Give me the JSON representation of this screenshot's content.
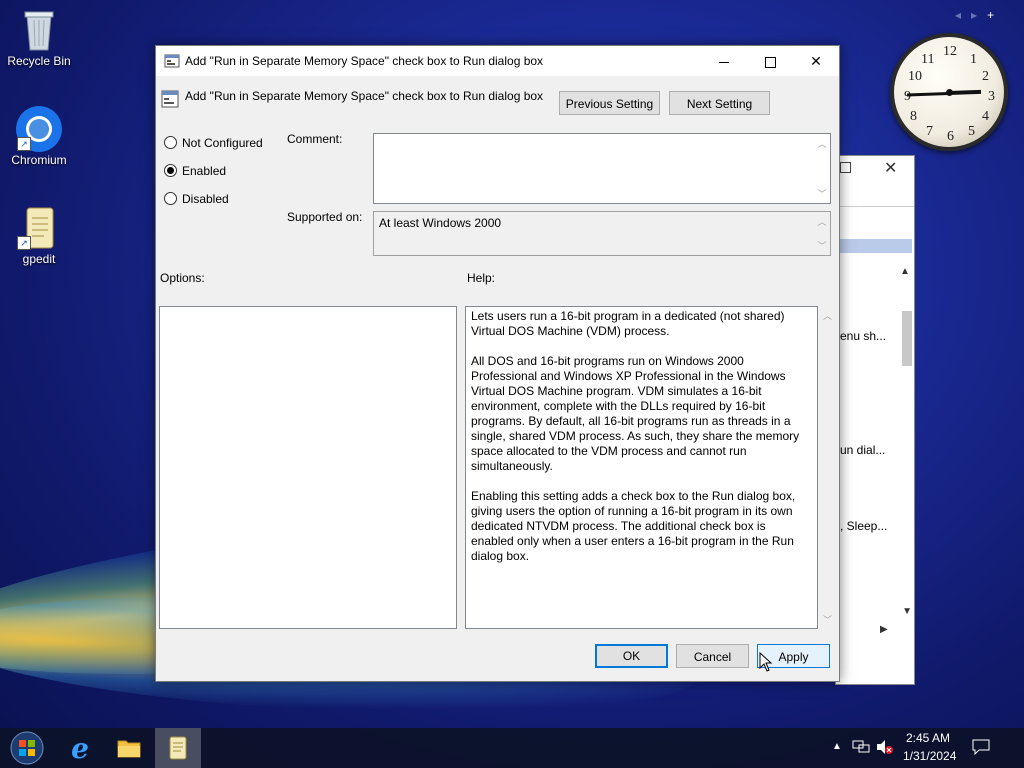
{
  "desktop": {
    "icons": [
      {
        "label": "Recycle Bin",
        "icon": "recycle-bin-icon"
      },
      {
        "label": "Chromium",
        "icon": "chromium-icon"
      },
      {
        "label": "gpedit",
        "icon": "gpedit-icon"
      }
    ],
    "top_right_glyphs": [
      "◂",
      "▸",
      "+"
    ]
  },
  "background_window": {
    "row1": "enu sh...",
    "row2": "un dial...",
    "row3": ", Sleep..."
  },
  "dialog": {
    "window_title": "Add \"Run in Separate Memory Space\" check box to Run dialog box",
    "setting_title": "Add \"Run in Separate Memory Space\" check box to Run dialog box",
    "prev_button": "Previous Setting",
    "next_button": "Next Setting",
    "radios": [
      {
        "label": "Not Configured",
        "selected": false
      },
      {
        "label": "Enabled",
        "selected": true
      },
      {
        "label": "Disabled",
        "selected": false
      }
    ],
    "comment_label": "Comment:",
    "comment_value": "",
    "supported_label": "Supported on:",
    "supported_value": "At least Windows 2000",
    "options_label": "Options:",
    "help_label": "Help:",
    "help_paragraphs": [
      "Lets users run a 16-bit program in a dedicated (not shared) Virtual DOS Machine (VDM) process.",
      "All DOS and 16-bit programs run on Windows 2000 Professional and Windows XP Professional in the Windows Virtual DOS Machine program. VDM simulates a 16-bit environment, complete with the DLLs required by 16-bit programs. By default, all 16-bit programs run as threads in a single, shared VDM process. As such, they share the memory space allocated to the VDM process and cannot run simultaneously.",
      "Enabling this setting adds a check box to the Run dialog box, giving users the option of running a 16-bit program in its own dedicated NTVDM process. The additional check box is enabled only when a user enters a 16-bit program in the Run dialog box."
    ],
    "ok_button": "OK",
    "cancel_button": "Cancel",
    "apply_button": "Apply"
  },
  "clock_widget": {
    "numbers": [
      "12",
      "1",
      "2",
      "3",
      "4",
      "5",
      "6",
      "7",
      "8",
      "9",
      "10",
      "11"
    ]
  },
  "taskbar": {
    "time": "2:45 AM",
    "date": "1/31/2024",
    "pinned": [
      "start-orb-icon",
      "internet-explorer-icon",
      "file-explorer-icon",
      "gpedit-icon"
    ]
  },
  "colors": {
    "accent": "#0078d7",
    "taskbar": "#0c1228",
    "desktop": "#1a2a95"
  }
}
